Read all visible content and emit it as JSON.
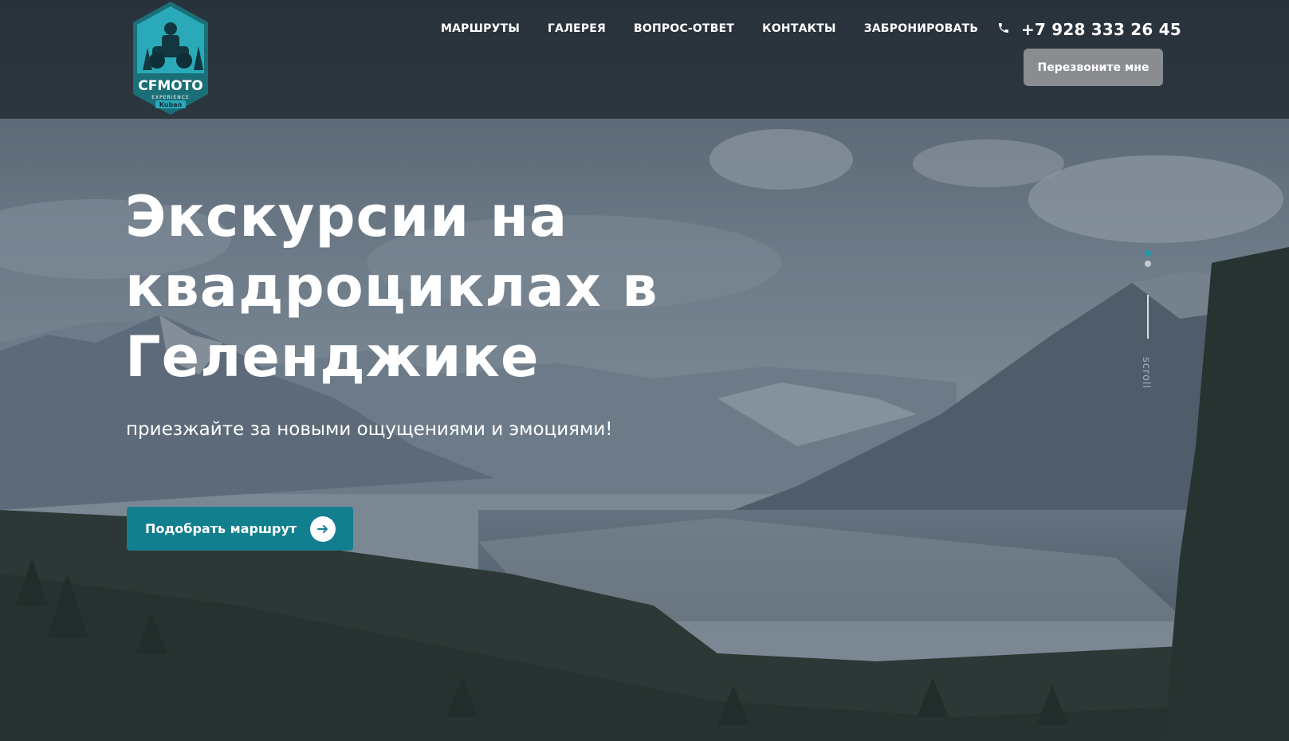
{
  "brand": {
    "logo_main": "CFMOTO",
    "logo_sub": "EXPERIENCE",
    "logo_region": "Kuban"
  },
  "nav": {
    "items": [
      {
        "label": "МАРШРУТЫ"
      },
      {
        "label": "ГАЛЕРЕЯ"
      },
      {
        "label": "ВОПРОС-ОТВЕТ"
      },
      {
        "label": "КОНТАКТЫ"
      },
      {
        "label": "ЗАБРОНИРОВАТЬ"
      }
    ]
  },
  "contact": {
    "phone": "+7 928 333 26 45",
    "callback_label": "Перезвоните мне",
    "phone_icon": "phone-icon"
  },
  "hero": {
    "title_line1": "Экскурсии на",
    "title_line2": "квадроциклах в",
    "title_line3": "Геленджике",
    "subtitle": "приезжайте за новыми ощущениями и эмоциями!",
    "cta_label": "Подобрать маршрут",
    "cta_icon": "arrow-right-icon"
  },
  "scroll": {
    "label": "scroll",
    "slides_total": 2,
    "active_slide": 1
  },
  "colors": {
    "accent": "#127f8f",
    "accent_dot": "#1f98a8",
    "callback_button": "#8a8d90",
    "header_bg": "#1a222a"
  }
}
